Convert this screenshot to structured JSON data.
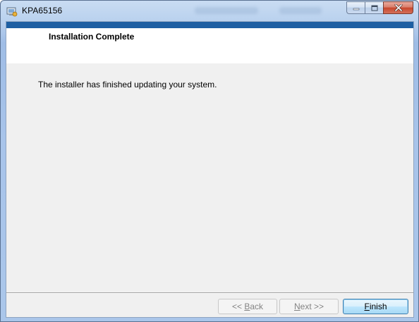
{
  "window": {
    "title": "KPA65156"
  },
  "header": {
    "title": "Installation Complete"
  },
  "main": {
    "message": "The installer has finished updating your system."
  },
  "buttons": {
    "back": {
      "prefix": "<< ",
      "accel": "B",
      "rest": "ack",
      "enabled": false
    },
    "next": {
      "accel": "N",
      "rest": "ext >>",
      "enabled": false
    },
    "finish": {
      "accel": "F",
      "rest": "inish",
      "enabled": true
    }
  },
  "icons": {
    "app": "installer-icon",
    "minimize": "minimize-icon",
    "maximize": "maximize-icon",
    "close": "close-icon"
  },
  "colors": {
    "banner_strip": "#1d5fa3",
    "dialog_background": "#f0f0f0",
    "header_background": "#ffffff",
    "close_button": "#c7462c"
  }
}
